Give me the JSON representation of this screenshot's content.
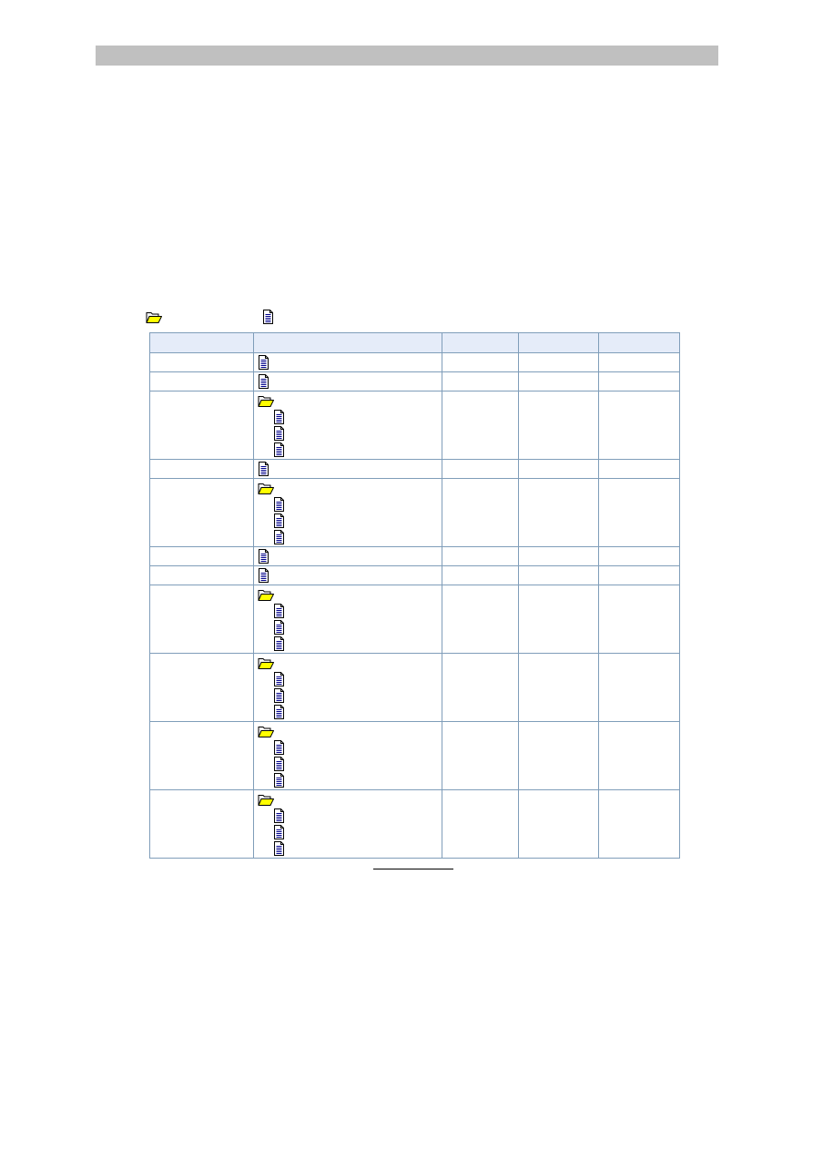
{
  "page": {
    "legend": [
      {
        "icon": "folder-open-icon",
        "label": ""
      },
      {
        "icon": "document-icon",
        "label": ""
      }
    ]
  },
  "table": {
    "headers": [
      "",
      "",
      "",
      "",
      ""
    ],
    "rows": [
      {
        "col1": "",
        "tree": [
          {
            "type": "document",
            "level": 0
          }
        ],
        "col3": "",
        "col4": "",
        "col5": ""
      },
      {
        "col1": "",
        "tree": [
          {
            "type": "document",
            "level": 0
          }
        ],
        "col3": "",
        "col4": "",
        "col5": ""
      },
      {
        "col1": "",
        "tree": [
          {
            "type": "folder",
            "level": 0
          },
          {
            "type": "document",
            "level": 1
          },
          {
            "type": "document",
            "level": 1
          },
          {
            "type": "document",
            "level": 1
          }
        ],
        "col3": "",
        "col4": "",
        "col5": ""
      },
      {
        "col1": "",
        "tree": [
          {
            "type": "document",
            "level": 0
          }
        ],
        "col3": "",
        "col4": "",
        "col5": ""
      },
      {
        "col1": "",
        "tree": [
          {
            "type": "folder",
            "level": 0
          },
          {
            "type": "document",
            "level": 1
          },
          {
            "type": "document",
            "level": 1
          },
          {
            "type": "document",
            "level": 1
          }
        ],
        "col3": "",
        "col4": "",
        "col5": ""
      },
      {
        "col1": "",
        "tree": [
          {
            "type": "document",
            "level": 0
          }
        ],
        "col3": "",
        "col4": "",
        "col5": ""
      },
      {
        "col1": "",
        "tree": [
          {
            "type": "document",
            "level": 0
          }
        ],
        "col3": "",
        "col4": "",
        "col5": ""
      },
      {
        "col1": "",
        "tree": [
          {
            "type": "folder",
            "level": 0
          },
          {
            "type": "document",
            "level": 1
          },
          {
            "type": "document",
            "level": 1
          },
          {
            "type": "document",
            "level": 1
          }
        ],
        "col3": "",
        "col4": "",
        "col5": ""
      },
      {
        "col1": "",
        "tree": [
          {
            "type": "folder",
            "level": 0
          },
          {
            "type": "document",
            "level": 1
          },
          {
            "type": "document",
            "level": 1
          },
          {
            "type": "document",
            "level": 1
          }
        ],
        "col3": "",
        "col4": "",
        "col5": ""
      },
      {
        "col1": "",
        "tree": [
          {
            "type": "folder",
            "level": 0
          },
          {
            "type": "document",
            "level": 1
          },
          {
            "type": "document",
            "level": 1
          },
          {
            "type": "document",
            "level": 1
          }
        ],
        "col3": "",
        "col4": "",
        "col5": ""
      },
      {
        "col1": "",
        "tree": [
          {
            "type": "folder",
            "level": 0
          },
          {
            "type": "document",
            "level": 1
          },
          {
            "type": "document",
            "level": 1
          },
          {
            "type": "document",
            "level": 1
          }
        ],
        "col3": "",
        "col4": "",
        "col5": ""
      }
    ]
  },
  "colors": {
    "header_bar": "#c0c0c0",
    "table_border": "#7f9db9",
    "table_header_bg": "#e5ecf9",
    "folder_fill": "#ffff00",
    "document_lines": "#00008b"
  }
}
